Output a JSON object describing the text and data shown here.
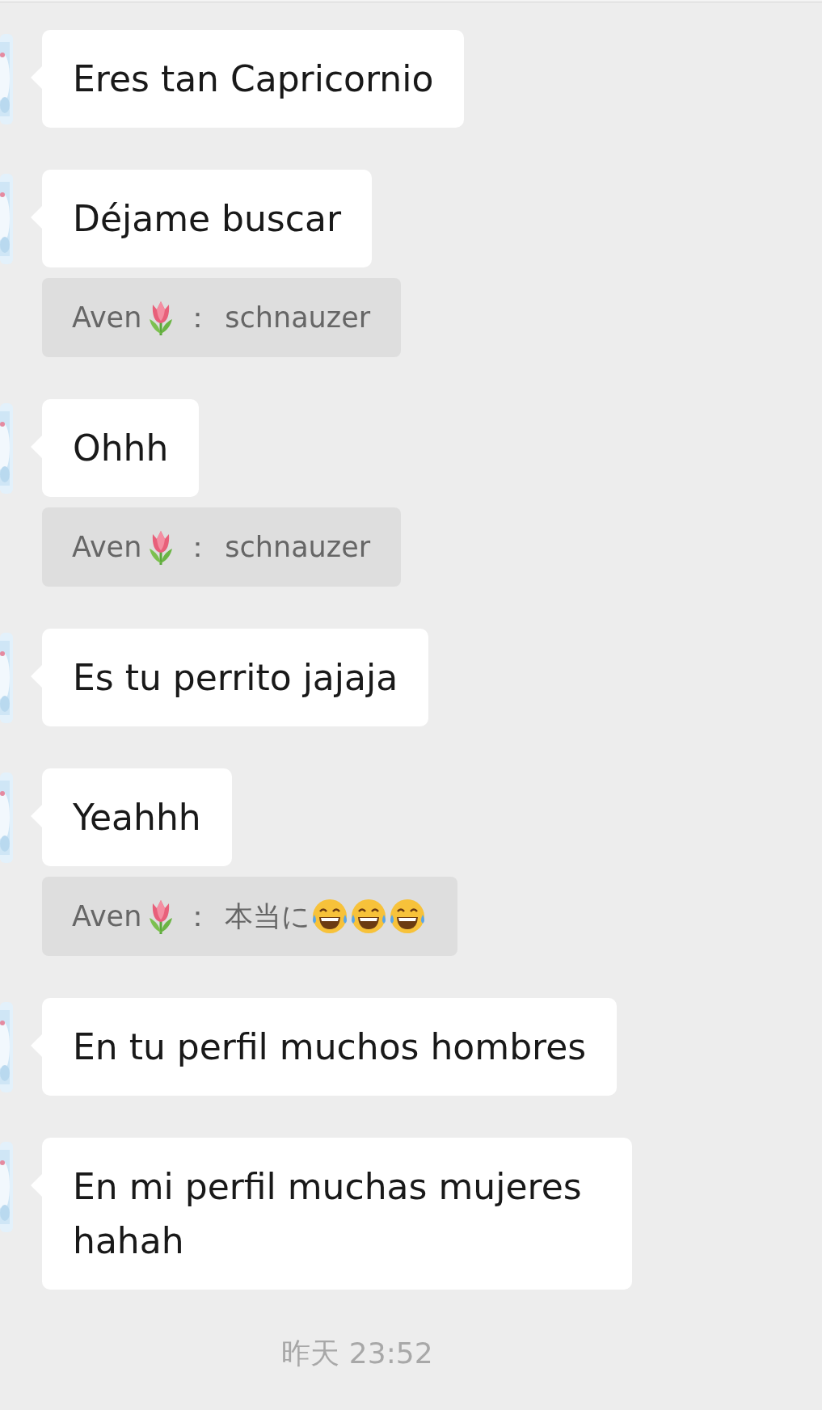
{
  "messages": [
    {
      "text": "Eres tan Capricornio"
    },
    {
      "text": "Déjame buscar",
      "quote": [
        {
          "kind": "text",
          "text": "Aven"
        },
        {
          "kind": "tulip"
        },
        {
          "kind": "text",
          "text": "："
        },
        {
          "kind": "text",
          "text": "schnauzer"
        }
      ]
    },
    {
      "text": "Ohhh",
      "quote": [
        {
          "kind": "text",
          "text": "Aven"
        },
        {
          "kind": "tulip"
        },
        {
          "kind": "text",
          "text": "："
        },
        {
          "kind": "text",
          "text": "schnauzer"
        }
      ]
    },
    {
      "text": "Es tu perrito jajaja"
    },
    {
      "text": "Yeahhh",
      "quote": [
        {
          "kind": "text",
          "text": "Aven"
        },
        {
          "kind": "tulip"
        },
        {
          "kind": "text",
          "text": "："
        },
        {
          "kind": "text",
          "text": "本当に"
        },
        {
          "kind": "laugh"
        },
        {
          "kind": "laugh"
        },
        {
          "kind": "laugh"
        }
      ]
    },
    {
      "text": "En tu perfil muchos hombres"
    },
    {
      "text": "En mi perfil muchas mujeres hahah"
    }
  ],
  "timestamp": "昨天 23:52"
}
